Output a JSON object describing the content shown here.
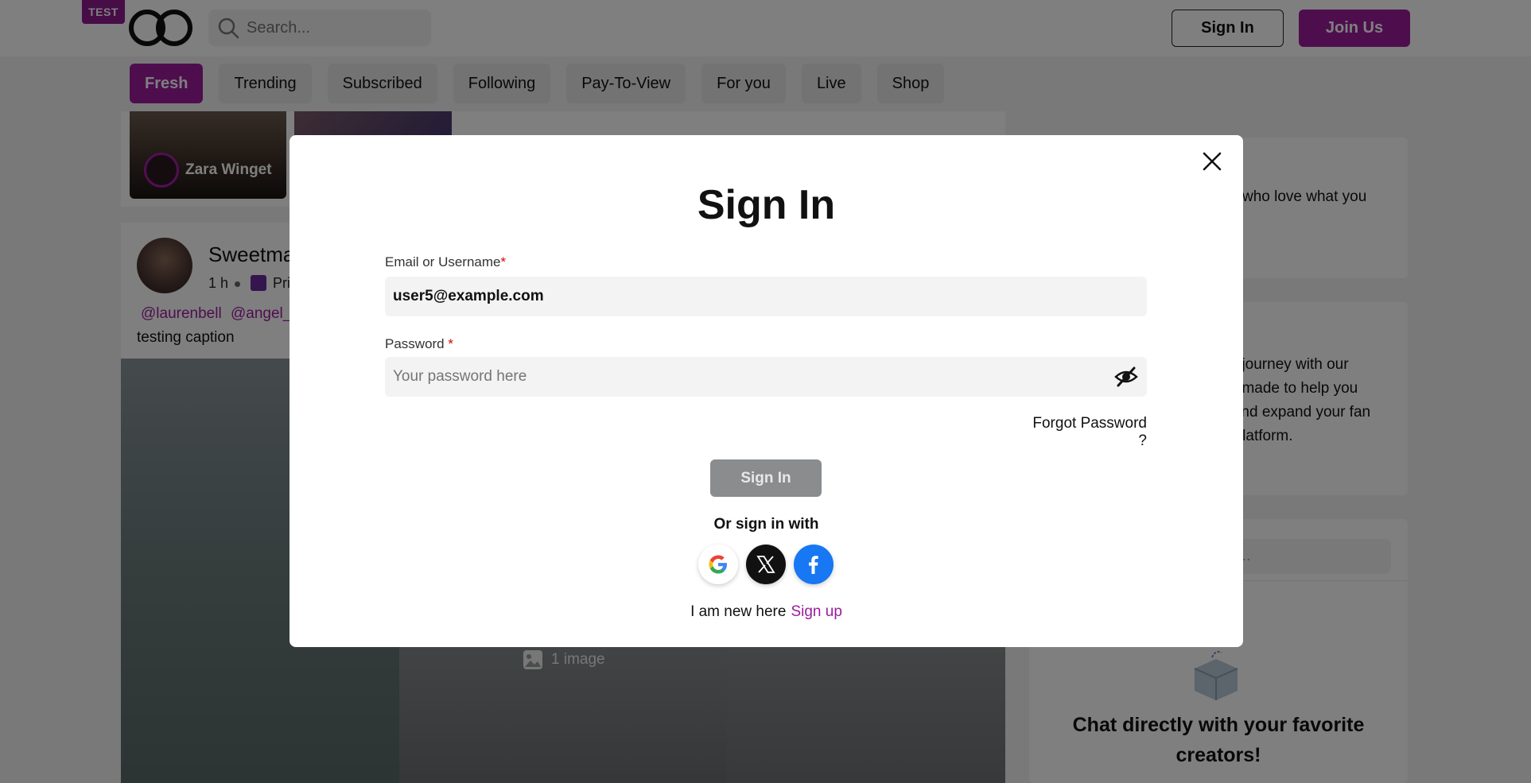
{
  "header": {
    "badge": "TEST",
    "search_placeholder": "Search...",
    "sign_in_label": "Sign In",
    "join_label": "Join Us"
  },
  "tabs": [
    {
      "label": "Fresh",
      "active": true
    },
    {
      "label": "Trending"
    },
    {
      "label": "Subscribed"
    },
    {
      "label": "Following"
    },
    {
      "label": "Pay-To-View"
    },
    {
      "label": "For you"
    },
    {
      "label": "Live"
    },
    {
      "label": "Shop"
    }
  ],
  "feed": {
    "featured_creator": "Zara Winget",
    "post": {
      "author": "Sweetma",
      "time": "1 h",
      "privacy": "Pri",
      "mentions": [
        "@laurenbell",
        "@angel_"
      ],
      "caption": "testing caption",
      "image_count": "1 image"
    }
  },
  "sidebar": {
    "card1_text": "who love what you",
    "card2_lines": [
      "tor journey with our",
      "lor-made to help you",
      "e and expand your fan",
      "Y platform."
    ],
    "search_placeholder": "rch...",
    "chat_title": "Chat directly with your favorite creators!"
  },
  "modal": {
    "title": "Sign In",
    "email_label": "Email or Username",
    "email_value": "user5@example.com",
    "password_label": "Password",
    "password_placeholder": "Your password here",
    "forgot": "Forgot Password ?",
    "submit": "Sign In",
    "or_text": "Or sign in with",
    "new_here": "I am new here",
    "signup": "Sign up",
    "required_mark": "*"
  },
  "colors": {
    "brand": "#9c1c9c",
    "overlay": "rgba(0,0,0,0.5)",
    "facebook": "#1877f2"
  }
}
